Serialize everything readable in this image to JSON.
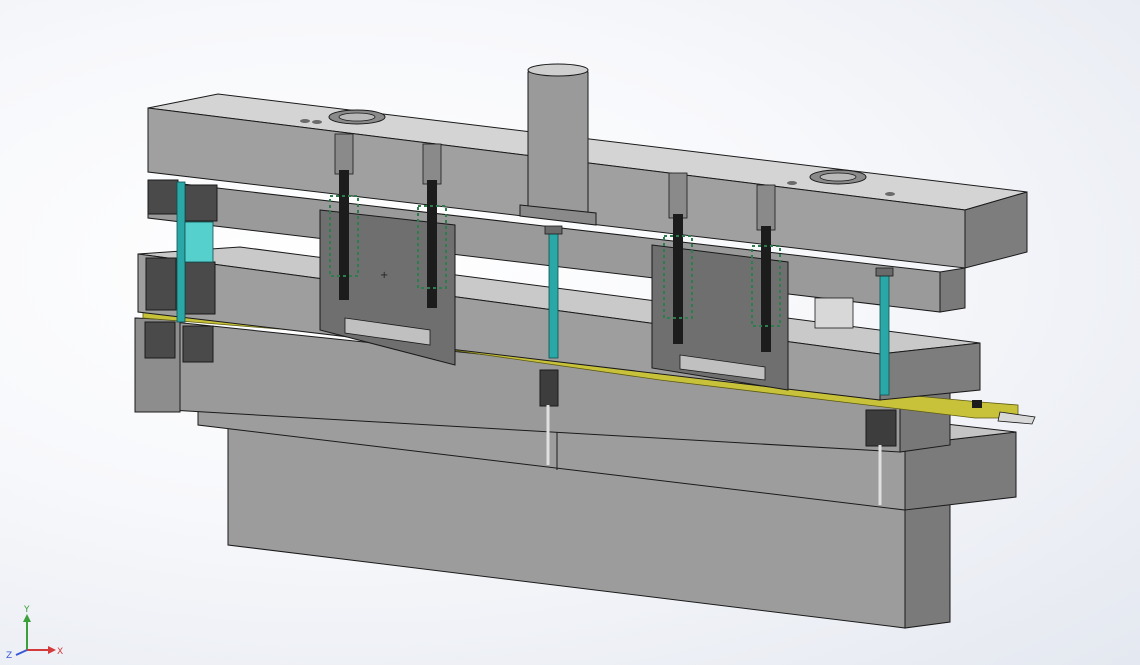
{
  "viewport": {
    "background_top": "#ffffff",
    "background_edge": "#e4e8f0"
  },
  "model": {
    "colors": {
      "steel_top": "#d2d2d2",
      "steel_face": "#a3a3a3",
      "steel_dark": "#6e6e6e",
      "steel_edge": "#1a1a1a",
      "steel_shadow": "#4a4a4a",
      "guide_pillar": "#2aa8a8",
      "guide_pillar_light": "#56d0cc",
      "strip": "#c8c23a",
      "strip_dark": "#8d8a1f",
      "spring": "#2e7d4f",
      "spring_dark": "#1b4b30",
      "bolt": "#1c1c1c",
      "screw_head": "#5a5a5a"
    }
  },
  "triad": {
    "y_label": "Y",
    "x_label": "X",
    "z_label": "Z",
    "x_color": "#d43a3a",
    "y_color": "#3aa03a",
    "z_color": "#3a5ad4"
  }
}
